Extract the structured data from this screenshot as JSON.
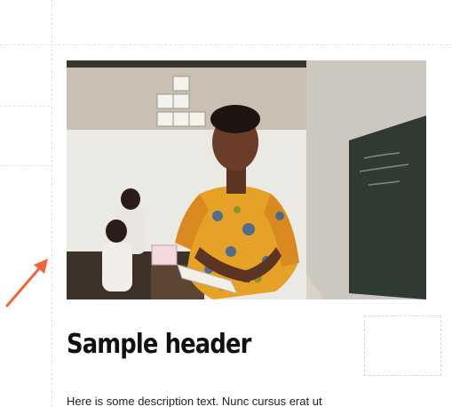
{
  "content": {
    "image": {
      "alt": "Student reading a book in a classroom",
      "icon": "photo"
    },
    "header": "Sample header",
    "description": "Here is some description text. Nunc cursus erat ut"
  },
  "annotation": {
    "arrow_color": "#f0643c",
    "icon": "arrow-up-right-icon"
  },
  "colors": {
    "guide": "#e3e3e3",
    "text": "#111111"
  }
}
